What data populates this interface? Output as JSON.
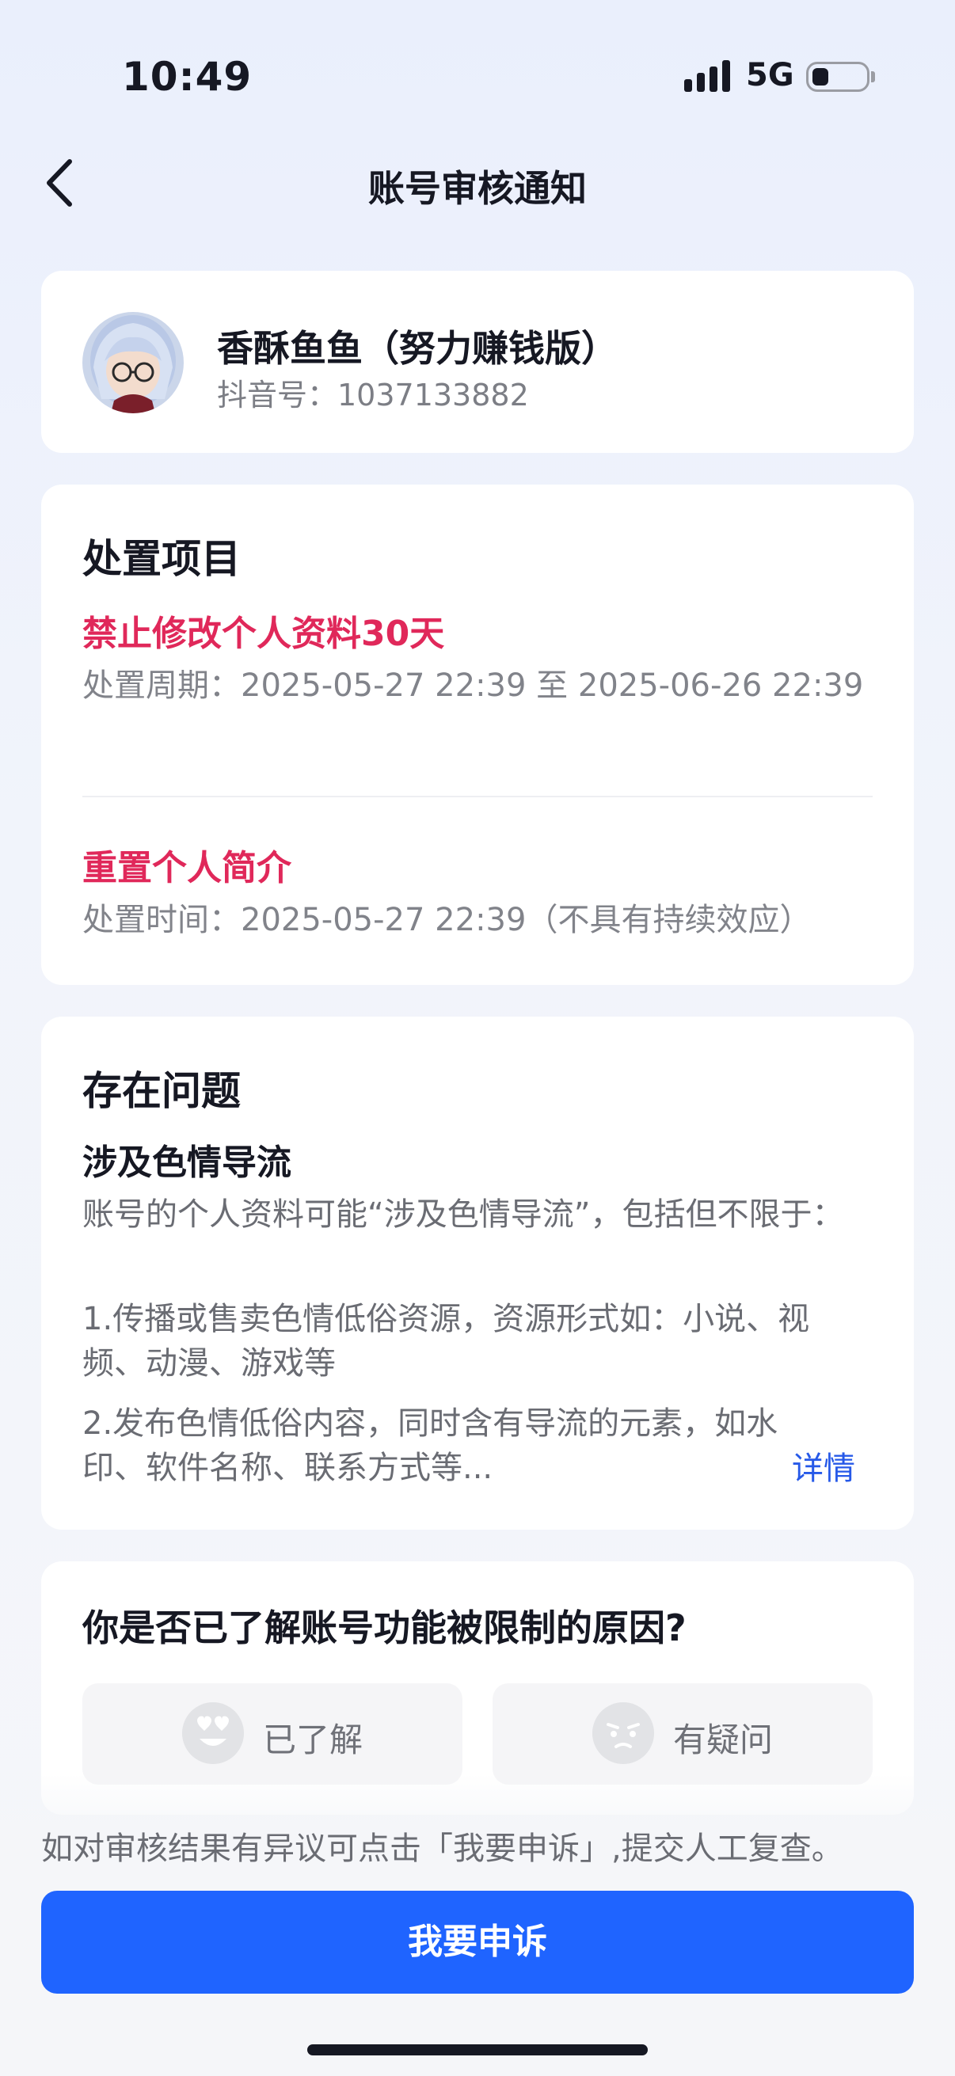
{
  "status_bar": {
    "time": "10:49",
    "network": "5G"
  },
  "nav": {
    "title": "账号审核通知"
  },
  "user": {
    "name": "香酥鱼鱼（努力赚钱版）",
    "id_line": "抖音号：1037133882"
  },
  "disposition": {
    "title": "处置项目",
    "items": [
      {
        "name": "禁止修改个人资料30天",
        "period": "处置周期：2025-05-27 22:39 至 2025-06-26 22:39"
      },
      {
        "name": "重置个人简介",
        "period": "处置时间：2025-05-27 22:39（不具有持续效应）"
      }
    ]
  },
  "issue": {
    "title": "存在问题",
    "subtitle": "涉及色情导流",
    "intro": "账号的个人资料可能“涉及色情导流”，包括但不限于：",
    "points": [
      "1.传播或售卖色情低俗资源，资源形式如：小说、视频、动漫、游戏等",
      "2.发布色情低俗内容，同时含有导流的元素，如水印、软件名称、联系方式等..."
    ],
    "detail_link": "详情"
  },
  "feedback": {
    "question": "你是否已了解账号功能被限制的原因?",
    "options": [
      {
        "label": "已了解",
        "icon": "heart-eyes-face-icon"
      },
      {
        "label": "有疑问",
        "icon": "confused-face-icon"
      }
    ]
  },
  "appeal": {
    "hint": "如对审核结果有异议可点击「我要申诉」,提交人工复查。",
    "button_label": "我要申诉",
    "button_color": "#1f64ff"
  },
  "colors": {
    "accent_red": "#e0285a",
    "link_blue": "#2659e8"
  }
}
